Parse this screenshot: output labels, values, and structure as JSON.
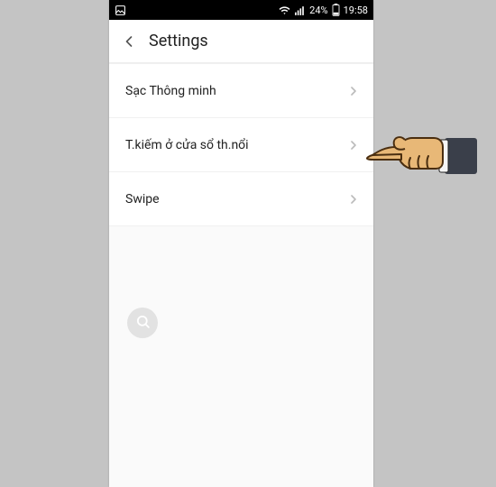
{
  "statusbar": {
    "battery_text": "24%",
    "time": "19:58"
  },
  "header": {
    "title": "Settings"
  },
  "settings": {
    "items": [
      {
        "label": "Sạc Thông minh"
      },
      {
        "label": "T.kiếm ở cửa sổ th.nổi"
      },
      {
        "label": "Swipe"
      }
    ]
  }
}
